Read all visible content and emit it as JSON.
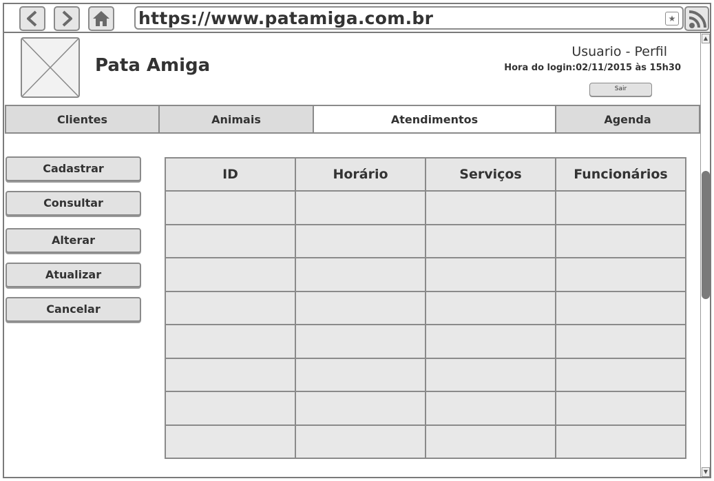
{
  "browser": {
    "url": "https://www.patamiga.com.br",
    "back_icon": "back-arrow-icon",
    "forward_icon": "forward-arrow-icon",
    "home_icon": "home-icon",
    "bookmark_icon": "star-icon",
    "rss_icon": "rss-icon"
  },
  "header": {
    "brand": "Pata Amiga",
    "user_title": "Usuario - Perfil",
    "login_time": "Hora do login:02/11/2015 às 15h30",
    "logout_label": "Sair"
  },
  "tabs": [
    {
      "label": "Clientes",
      "active": false
    },
    {
      "label": "Animais",
      "active": false
    },
    {
      "label": "Atendimentos",
      "active": true
    },
    {
      "label": "Agenda",
      "active": false
    }
  ],
  "actions": [
    {
      "label": "Cadastrar"
    },
    {
      "label": "Consultar"
    },
    {
      "label": "Alterar"
    },
    {
      "label": "Atualizar"
    },
    {
      "label": "Cancelar"
    }
  ],
  "table": {
    "columns": [
      "ID",
      "Horário",
      "Serviços",
      "Funcionários"
    ],
    "rows": [
      [
        "",
        "",
        "",
        ""
      ],
      [
        "",
        "",
        "",
        ""
      ],
      [
        "",
        "",
        "",
        ""
      ],
      [
        "",
        "",
        "",
        ""
      ],
      [
        "",
        "",
        "",
        ""
      ],
      [
        "",
        "",
        "",
        ""
      ],
      [
        "",
        "",
        "",
        ""
      ],
      [
        "",
        "",
        "",
        ""
      ]
    ]
  },
  "colors": {
    "border": "#8a8a8a",
    "fill": "#e2e2e2",
    "active_tab": "#ffffff",
    "scroll_thumb": "#7a7a7a"
  }
}
